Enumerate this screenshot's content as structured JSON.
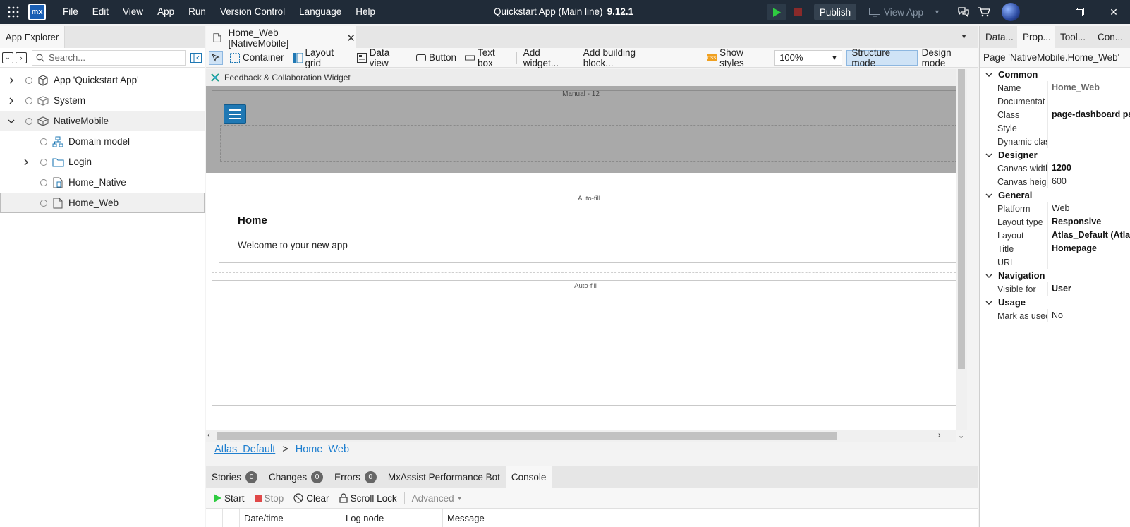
{
  "menu": [
    "File",
    "Edit",
    "View",
    "App",
    "Run",
    "Version Control",
    "Language",
    "Help"
  ],
  "title_bar": {
    "app_title": "Quickstart App (Main line)",
    "version": "9.12.1",
    "publish_label": "Publish",
    "view_app_label": "View App",
    "logo_text": "mx"
  },
  "left_panel": {
    "title": "App Explorer",
    "search_placeholder": "Search...",
    "tree": [
      {
        "label": "App 'Quickstart App'",
        "icon": "app-cube-icon",
        "expanded": false
      },
      {
        "label": "System",
        "icon": "module-icon",
        "expanded": false
      },
      {
        "label": "NativeMobile",
        "icon": "module-icon",
        "expanded": true
      },
      {
        "label": "Domain model",
        "icon": "domain-model-icon"
      },
      {
        "label": "Login",
        "icon": "folder-icon",
        "expanded": false
      },
      {
        "label": "Home_Native",
        "icon": "native-page-icon"
      },
      {
        "label": "Home_Web",
        "icon": "page-icon",
        "selected": true
      }
    ]
  },
  "editor": {
    "tab_label": "Home_Web [NativeMobile]",
    "toolbar": {
      "container": "Container",
      "layout_grid": "Layout grid",
      "data_view": "Data view",
      "button": "Button",
      "text_box": "Text box",
      "add_widget": "Add widget...",
      "add_building_block": "Add building block...",
      "show_styles": "Show styles",
      "zoom": "100%",
      "structure_mode": "Structure mode",
      "design_mode": "Design mode"
    },
    "canvas": {
      "widget_label": "Feedback & Collaboration Widget",
      "manual_label": "Manual - 12",
      "autofill_label_1": "Auto-fill",
      "autofill_label_2": "Auto-fill",
      "heading": "Home",
      "welcome_text": "Welcome to your new app"
    },
    "breadcrumb": {
      "layout": "Atlas_Default",
      "separator": ">",
      "page": "Home_Web"
    }
  },
  "bottom_panel": {
    "tabs": [
      {
        "label": "Stories",
        "count": "0"
      },
      {
        "label": "Changes",
        "count": "0"
      },
      {
        "label": "Errors",
        "count": "0"
      },
      {
        "label": "MxAssist Performance Bot"
      },
      {
        "label": "Console",
        "active": true
      }
    ],
    "tools": {
      "start": "Start",
      "stop": "Stop",
      "clear": "Clear",
      "scroll_lock": "Scroll Lock",
      "advanced": "Advanced"
    },
    "columns": [
      "Date/time",
      "Log node",
      "Message"
    ]
  },
  "right_panel": {
    "tabs": [
      "Data...",
      "Prop...",
      "Tool...",
      "Con..."
    ],
    "title": "Page 'NativeMobile.Home_Web'",
    "sections": {
      "common": "Common",
      "designer": "Designer",
      "general": "General",
      "navigation": "Navigation",
      "usage": "Usage"
    },
    "props": {
      "name_key": "Name",
      "name_val": "Home_Web",
      "doc_key": "Documentat",
      "doc_val": "",
      "class_key": "Class",
      "class_val": "page-dashboard pa",
      "style_key": "Style",
      "style_val": "",
      "dynclass_key": "Dynamic clas",
      "dynclass_val": "",
      "cw_key": "Canvas widtl",
      "cw_val": "1200",
      "ch_key": "Canvas heigl",
      "ch_val": "600",
      "platform_key": "Platform",
      "platform_val": "Web",
      "layouttype_key": "Layout type",
      "layouttype_val": "Responsive",
      "layout_key": "Layout",
      "layout_val": "Atlas_Default (Atla",
      "title_key": "Title",
      "title_val": "Homepage",
      "url_key": "URL",
      "url_val": "",
      "visible_key": "Visible for",
      "visible_val": "User",
      "used_key": "Mark as usec",
      "used_val": "No"
    }
  },
  "colors": {
    "titlebar": "#202b38",
    "accent": "#1f78b4",
    "link": "#1f7fcf",
    "run_green": "#2ecc40",
    "stop_red": "#d9342b"
  }
}
